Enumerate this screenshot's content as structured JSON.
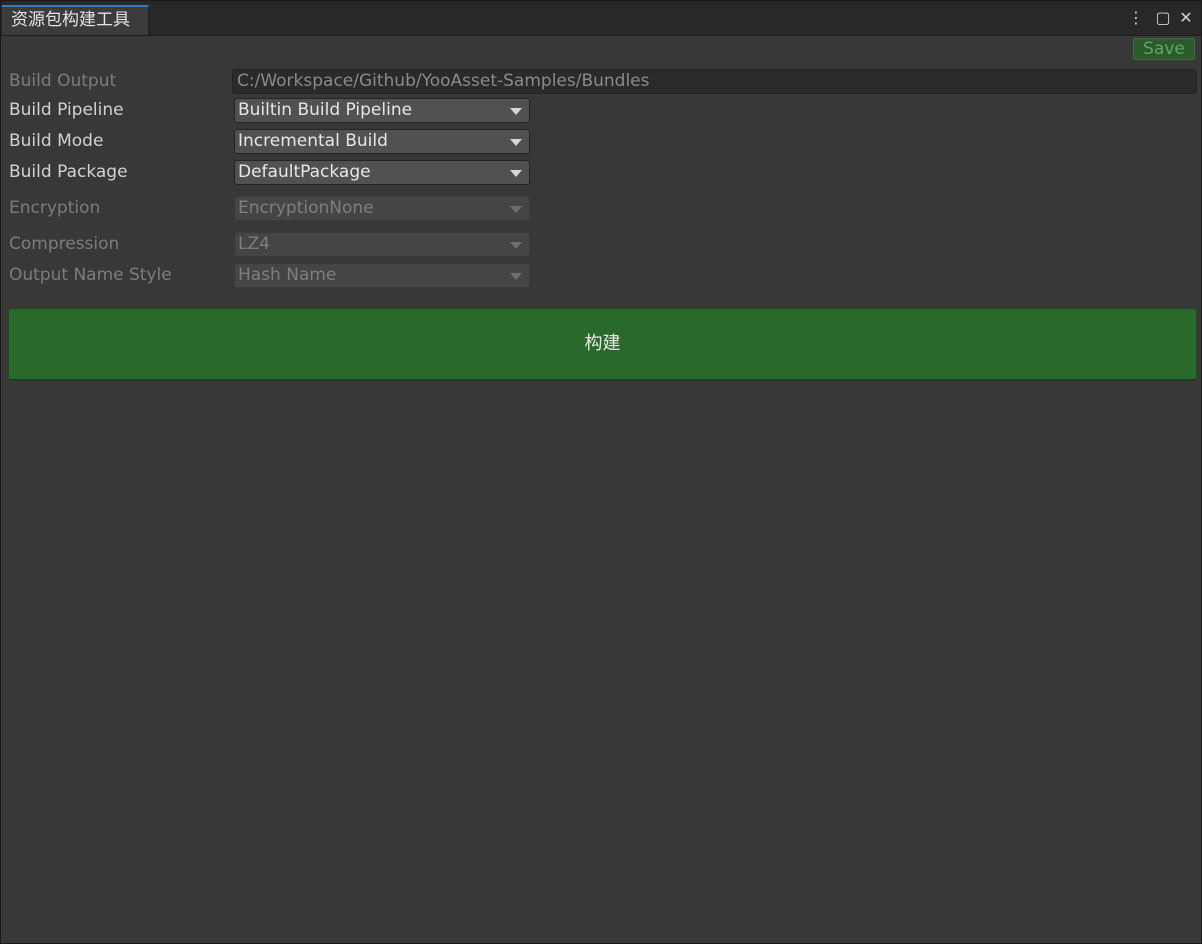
{
  "window": {
    "tab_title": "资源包构建工具",
    "controls": {
      "more_glyph": "⋮",
      "maximize_glyph": "▢",
      "close_glyph": "✕"
    }
  },
  "toolbar": {
    "save_label": "Save"
  },
  "fields": {
    "build_output": {
      "label": "Build Output",
      "value": "C:/Workspace/Github/YooAsset-Samples/Bundles"
    },
    "build_pipeline": {
      "label": "Build Pipeline",
      "value": "Builtin Build Pipeline"
    },
    "build_mode": {
      "label": "Build Mode",
      "value": "Incremental Build"
    },
    "build_package": {
      "label": "Build Package",
      "value": "DefaultPackage"
    },
    "encryption": {
      "label": "Encryption",
      "value": "EncryptionNone"
    },
    "compression": {
      "label": "Compression",
      "value": "LZ4"
    },
    "output_name_style": {
      "label": "Output Name Style",
      "value": "Hash Name"
    }
  },
  "build_button": {
    "label": "构建"
  },
  "colors": {
    "accent_tab": "#3a79bb",
    "build_green": "#296a2a",
    "panel_bg": "#383838"
  }
}
